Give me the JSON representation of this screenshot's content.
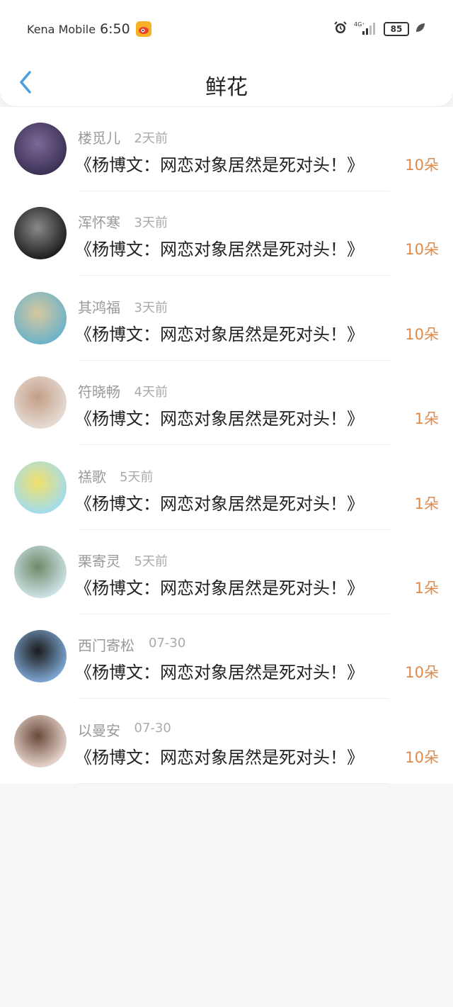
{
  "status_bar": {
    "carrier": "Kena Mobile",
    "time": "6:50",
    "network": "4G⁺",
    "battery": "85"
  },
  "nav": {
    "title": "鲜花"
  },
  "colors": {
    "accent": "#4a9ee0",
    "count": "#e08a4a",
    "muted": "#999999"
  },
  "items": [
    {
      "name": "楼觅儿",
      "time": "2天前",
      "book": "《杨博文：网恋对象居然是死对头！》",
      "count": "10朵",
      "avatar_colors": [
        "#3a2f52",
        "#7c6a9a"
      ]
    },
    {
      "name": "浑怀寒",
      "time": "3天前",
      "book": "《杨博文：网恋对象居然是死对头！》",
      "count": "10朵",
      "avatar_colors": [
        "#1c1c1c",
        "#8a8a8a"
      ]
    },
    {
      "name": "其鸿福",
      "time": "3天前",
      "book": "《杨博文：网恋对象居然是死对头！》",
      "count": "10朵",
      "avatar_colors": [
        "#6ab2c9",
        "#d8c8a0"
      ]
    },
    {
      "name": "符晓畅",
      "time": "4天前",
      "book": "《杨博文：网恋对象居然是死对头！》",
      "count": "1朵",
      "avatar_colors": [
        "#e6ddd6",
        "#c49e86"
      ]
    },
    {
      "name": "禚歌",
      "time": "5天前",
      "book": "《杨博文：网恋对象居然是死对头！》",
      "count": "1朵",
      "avatar_colors": [
        "#9fdcf0",
        "#f3e06a"
      ]
    },
    {
      "name": "栗寄灵",
      "time": "5天前",
      "book": "《杨博文：网恋对象居然是死对头！》",
      "count": "1朵",
      "avatar_colors": [
        "#cfe4e8",
        "#6e8a6a"
      ]
    },
    {
      "name": "西门寄松",
      "time": "07-30",
      "book": "《杨博文：网恋对象居然是死对头！》",
      "count": "10朵",
      "avatar_colors": [
        "#7fa9d6",
        "#1a1a1a"
      ]
    },
    {
      "name": "以曼安",
      "time": "07-30",
      "book": "《杨博文：网恋对象居然是死对头！》",
      "count": "10朵",
      "avatar_colors": [
        "#e9d7cf",
        "#6a4a3a"
      ]
    }
  ]
}
